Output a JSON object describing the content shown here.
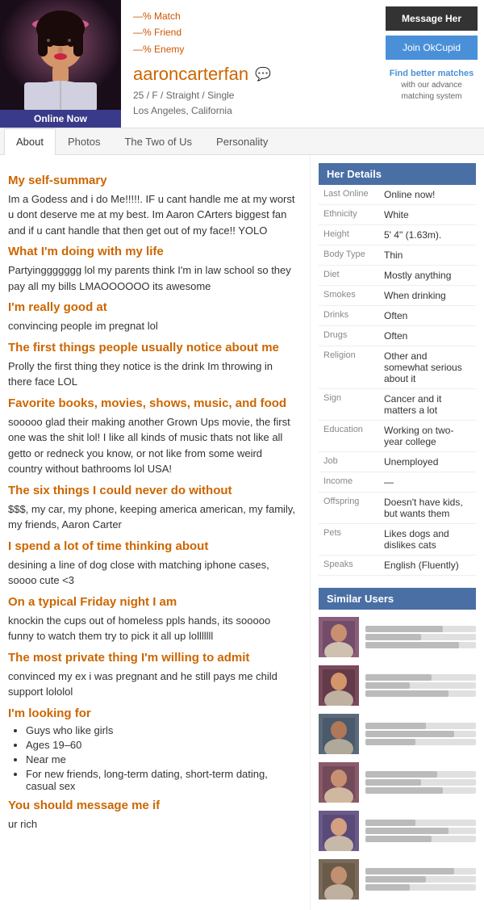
{
  "header": {
    "online_badge": "Online Now",
    "match_percent": "—%",
    "friend_percent": "—%",
    "enemy_percent": "—%",
    "match_label": "Match",
    "friend_label": "Friend",
    "enemy_label": "Enemy",
    "username": "aaroncarterfan",
    "age": "25",
    "gender": "F",
    "orientation": "Straight",
    "status": "Single",
    "location": "Los Angeles, California",
    "btn_message": "Message Her",
    "btn_join": "Join OkCupid",
    "find_better": "Find better matches",
    "find_better_sub": "with our advance matching system"
  },
  "tabs": [
    {
      "label": "About",
      "active": true
    },
    {
      "label": "Photos",
      "active": false
    },
    {
      "label": "The Two of Us",
      "active": false
    },
    {
      "label": "Personality",
      "active": false
    }
  ],
  "sections": [
    {
      "title": "My self-summary",
      "text": "Im a Godess and i do Me!!!!!. IF u cant handle me at my worst u dont deserve me at my best. Im Aaron CArters biggest fan and if u cant handle that then get out of my face!! YOLO"
    },
    {
      "title": "What I'm doing with my life",
      "text": "Partyinggggggg lol my parents think I'm in law school so they pay all my bills LMAOOOOOO its awesome"
    },
    {
      "title": "I'm really good at",
      "text": "convincing people im pregnat lol"
    },
    {
      "title": "The first things people usually notice about me",
      "text": "Prolly the first thing they notice is the drink Im throwing in there face LOL"
    },
    {
      "title": "Favorite books, movies, shows, music, and food",
      "text": "sooooo glad their making another Grown Ups movie, the first one was the shit lol! I like all kinds of music thats not like all getto or redneck you know, or not like from some weird country without bathrooms lol USA!"
    },
    {
      "title": "The six things I could never do without",
      "text": "$$$, my car, my phone, keeping america american, my family, my friends, Aaron Carter"
    },
    {
      "title": "I spend a lot of time thinking about",
      "text": "desining a line of dog close with matching iphone cases, soooo cute <3"
    },
    {
      "title": "On a typical Friday night I am",
      "text": "knockin the cups out of homeless ppls hands, its sooooo funny to watch them try to pick it all up lolllllll"
    },
    {
      "title": "The most private thing I'm willing to admit",
      "text": "convinced my ex i was pregnant and he still pays me child support lololol"
    }
  ],
  "looking_for": {
    "title": "I'm looking for",
    "items": [
      "Guys who like girls",
      "Ages 19–60",
      "Near me",
      "For new friends, long-term dating, short-term dating, casual sex"
    ]
  },
  "message_if": {
    "title": "You should message me if",
    "text": "ur rich"
  },
  "details": {
    "header": "Her Details",
    "rows": [
      {
        "label": "Last Online",
        "value": "Online now!"
      },
      {
        "label": "Ethnicity",
        "value": "White"
      },
      {
        "label": "Height",
        "value": "5' 4\" (1.63m)."
      },
      {
        "label": "Body Type",
        "value": "Thin"
      },
      {
        "label": "Diet",
        "value": "Mostly anything"
      },
      {
        "label": "Smokes",
        "value": "When drinking"
      },
      {
        "label": "Drinks",
        "value": "Often"
      },
      {
        "label": "Drugs",
        "value": "Often"
      },
      {
        "label": "Religion",
        "value": "Other and somewhat serious about it"
      },
      {
        "label": "Sign",
        "value": "Cancer and it matters a lot"
      },
      {
        "label": "Education",
        "value": "Working on two-year college"
      },
      {
        "label": "Job",
        "value": "Unemployed"
      },
      {
        "label": "Income",
        "value": "—"
      },
      {
        "label": "Offspring",
        "value": "Doesn't have kids, but wants them"
      },
      {
        "label": "Pets",
        "value": "Likes dogs and dislikes cats"
      },
      {
        "label": "Speaks",
        "value": "English (Fluently)"
      }
    ]
  },
  "similar_users": {
    "header": "Similar Users",
    "items": [
      {
        "color1": "#8B5E7A",
        "color2": "#5a3a5a"
      },
      {
        "color1": "#7a4a5a",
        "color2": "#4a2a3a"
      },
      {
        "color1": "#5a6a7a",
        "color2": "#3a4a5a"
      },
      {
        "color1": "#8a5a6a",
        "color2": "#5a3a4a"
      },
      {
        "color1": "#6a5a8a",
        "color2": "#4a3a6a"
      },
      {
        "color1": "#7a6a5a",
        "color2": "#5a4a3a"
      }
    ]
  }
}
